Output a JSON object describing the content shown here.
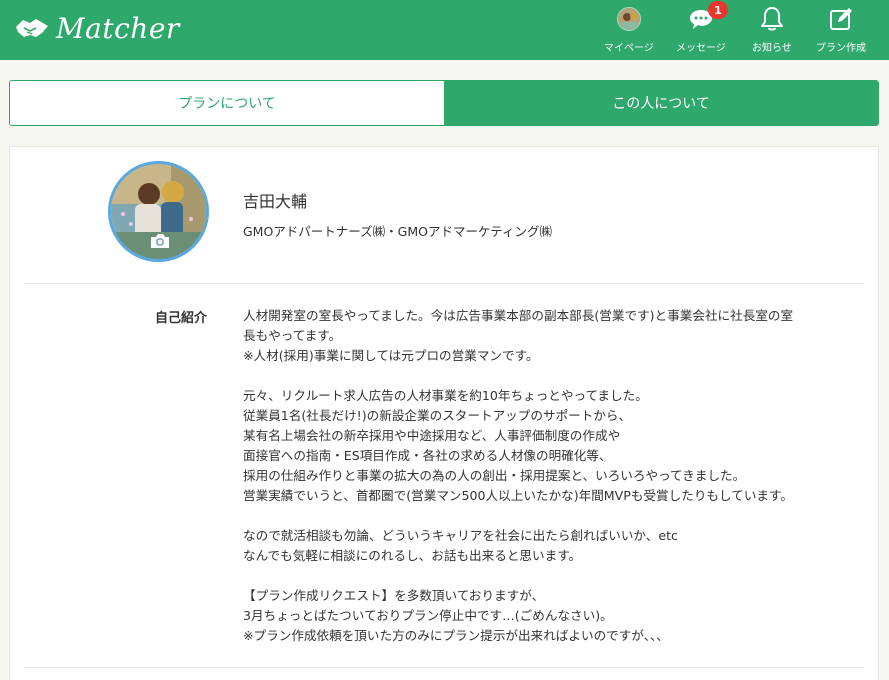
{
  "app": {
    "logo_text": "Matcher"
  },
  "nav": [
    {
      "label": "マイページ",
      "icon": "avatar"
    },
    {
      "label": "メッセージ",
      "icon": "message-icon",
      "badge": "1"
    },
    {
      "label": "お知らせ",
      "icon": "bell-icon"
    },
    {
      "label": "プラン作成",
      "icon": "edit-icon"
    }
  ],
  "tabs": {
    "plan_label": "プランについて",
    "person_label": "この人について"
  },
  "profile": {
    "name": "吉田大輔",
    "company": "GMOアドパートナーズ㈱・GMOアドマーケティング㈱"
  },
  "intro": {
    "label": "自己紹介",
    "lines": [
      "人材開発室の室長やってました。今は広告事業本部の副本部長(営業です)と事業会社に社長室の室",
      "長もやってます。",
      "※人材(採用)事業に関しては元プロの営業マンです。",
      "",
      "元々、リクルート求人広告の人材事業を約10年ちょっとやってました。",
      "従業員1名(社長だけ!)の新設企業のスタートアップのサポートから、",
      "某有名上場会社の新卒採用や中途採用など、人事評価制度の作成や",
      "面接官への指南・ES項目作成・各社の求める人材像の明確化等、",
      "採用の仕組み作りと事業の拡大の為の人の創出・採用提案と、いろいろやってきました。",
      "営業実績でいうと、首都圏で(営業マン500人以上いたかな)年間MVPも受賞したりもしています。",
      "",
      "なので就活相談も勿論、どういうキャリアを社会に出たら創ればいいか、etc",
      "なんでも気軽に相談にのれるし、お話も出来ると思います。",
      "",
      "【プラン作成リクエスト】を多数頂いておりますが、",
      "3月ちょっとばたついておりプラン停止中です…(ごめんなさい)。",
      "※プラン作成依頼を頂いた方のみにプラン提示が出来ればよいのですが、、、"
    ]
  },
  "colors": {
    "brand_green": "#2fa86b",
    "badge_red": "#e8372f",
    "photo_ring": "#5aa8e0"
  }
}
